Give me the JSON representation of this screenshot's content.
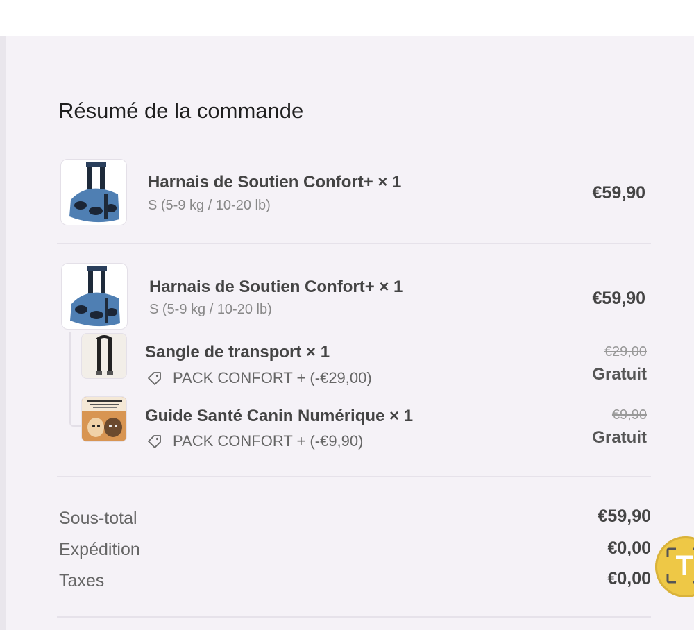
{
  "order_summary": {
    "title": "Résumé de la commande",
    "items": [
      {
        "name": "Harnais de Soutien Confort+ × 1",
        "variant": "S (5-9 kg / 10-20 lb)",
        "price": "€59,90",
        "image_icon": "harness-icon"
      },
      {
        "name": "Harnais de Soutien Confort+ × 1",
        "variant": "S (5-9 kg / 10-20 lb)",
        "price": "€59,90",
        "image_icon": "harness-icon",
        "bundle_items": [
          {
            "name": "Sangle de transport × 1",
            "discount": "PACK CONFORT + (-€29,00)",
            "original_price": "€29,00",
            "price": "Gratuit",
            "image_icon": "strap-icon"
          },
          {
            "name": "Guide Santé Canin Numérique × 1",
            "discount": "PACK CONFORT + (-€9,90)",
            "original_price": "€9,90",
            "price": "Gratuit",
            "image_icon": "guide-book-icon"
          }
        ]
      }
    ],
    "totals": {
      "subtotal_label": "Sous-total",
      "subtotal_value": "€59,90",
      "shipping_label": "Expédition",
      "shipping_value": "€0,00",
      "taxes_label": "Taxes",
      "taxes_value": "€0,00"
    }
  },
  "colors": {
    "panel_bg": "#f5f2f7",
    "divider": "#e6e2ea",
    "translate_button": "#eec846"
  }
}
